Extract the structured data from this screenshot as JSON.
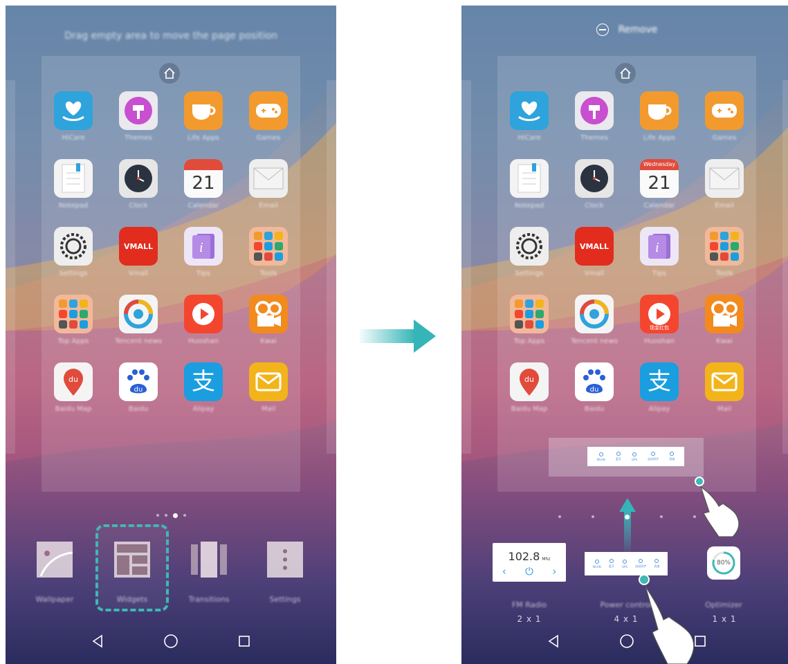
{
  "left_screen": {
    "hint": "Drag empty area to move the page position",
    "apps": [
      {
        "label": "HiCare",
        "icon": "heart-hand-icon",
        "color": "#2ea3dc"
      },
      {
        "label": "Themes",
        "icon": "brush-icon",
        "color": "#e9e9ee"
      },
      {
        "label": "Life Apps",
        "icon": "cup-icon",
        "color": "#f29a2e"
      },
      {
        "label": "Games",
        "icon": "gamepad-icon",
        "color": "#f29a2e"
      },
      {
        "label": "Notepad",
        "icon": "notepad-icon",
        "color": "#f3f3f3"
      },
      {
        "label": "Clock",
        "icon": "clock-icon",
        "color": "#e6e6e6"
      },
      {
        "label": "Calendar",
        "icon": "calendar-icon",
        "color": "#f4f4f4",
        "day": "21",
        "weekday": ""
      },
      {
        "label": "Email",
        "icon": "envelope-icon",
        "color": "#eeeeee"
      },
      {
        "label": "Settings",
        "icon": "gear-icon",
        "color": "#eeeeee"
      },
      {
        "label": "Vmall",
        "icon": "vmall-icon",
        "color": "#e12c1e",
        "text": "VMALL"
      },
      {
        "label": "Tips",
        "icon": "tips-icon",
        "color": "#ede6f6"
      },
      {
        "label": "Tools",
        "icon": "folder-icon",
        "color": "#f2b89a"
      },
      {
        "label": "Top Apps",
        "icon": "folder-icon",
        "color": "#f2b89a"
      },
      {
        "label": "Tencent news",
        "icon": "tencent-news-icon",
        "color": "#f4f4f4"
      },
      {
        "label": "Huoshan",
        "icon": "video-flame-icon",
        "color": "#f4462f"
      },
      {
        "label": "Kwai",
        "icon": "camera-icon",
        "color": "#f28a1e"
      },
      {
        "label": "Baidu Map",
        "icon": "map-pin-icon",
        "color": "#f4f4f4",
        "text": "du"
      },
      {
        "label": "Baidu",
        "icon": "paw-icon",
        "color": "#ffffff",
        "text": "du"
      },
      {
        "label": "Alipay",
        "icon": "alipay-icon",
        "color": "#1a9ee0",
        "text": "支"
      },
      {
        "label": "Mail",
        "icon": "mail-icon",
        "color": "#f2b41a"
      }
    ],
    "tray": [
      {
        "label": "Wallpaper",
        "icon": "wallpaper-icon"
      },
      {
        "label": "Widgets",
        "icon": "widgets-icon"
      },
      {
        "label": "Transitions",
        "icon": "transitions-icon"
      },
      {
        "label": "Settings",
        "icon": "settings-dots-icon"
      }
    ]
  },
  "right_screen": {
    "remove_label": "Remove",
    "calendar_weekday": "Wednesday",
    "calendar_day": "21",
    "huoshan_caption": "现金红包",
    "widgets": [
      {
        "label": "FM Radio",
        "size": "2 x 1"
      },
      {
        "label": "Power control",
        "size": "4 x 1"
      },
      {
        "label": "Optimizer",
        "size": "1 x 1"
      }
    ],
    "fm_frequency": "102.8",
    "fm_unit": "Mhz",
    "battery_percent": "80%",
    "toggles": [
      "WLAN",
      "蓝牙",
      "GPS",
      "自动同步",
      "亮度"
    ]
  },
  "colors": {
    "accent": "#3fb8b6",
    "arrow": "#35b5b8"
  }
}
